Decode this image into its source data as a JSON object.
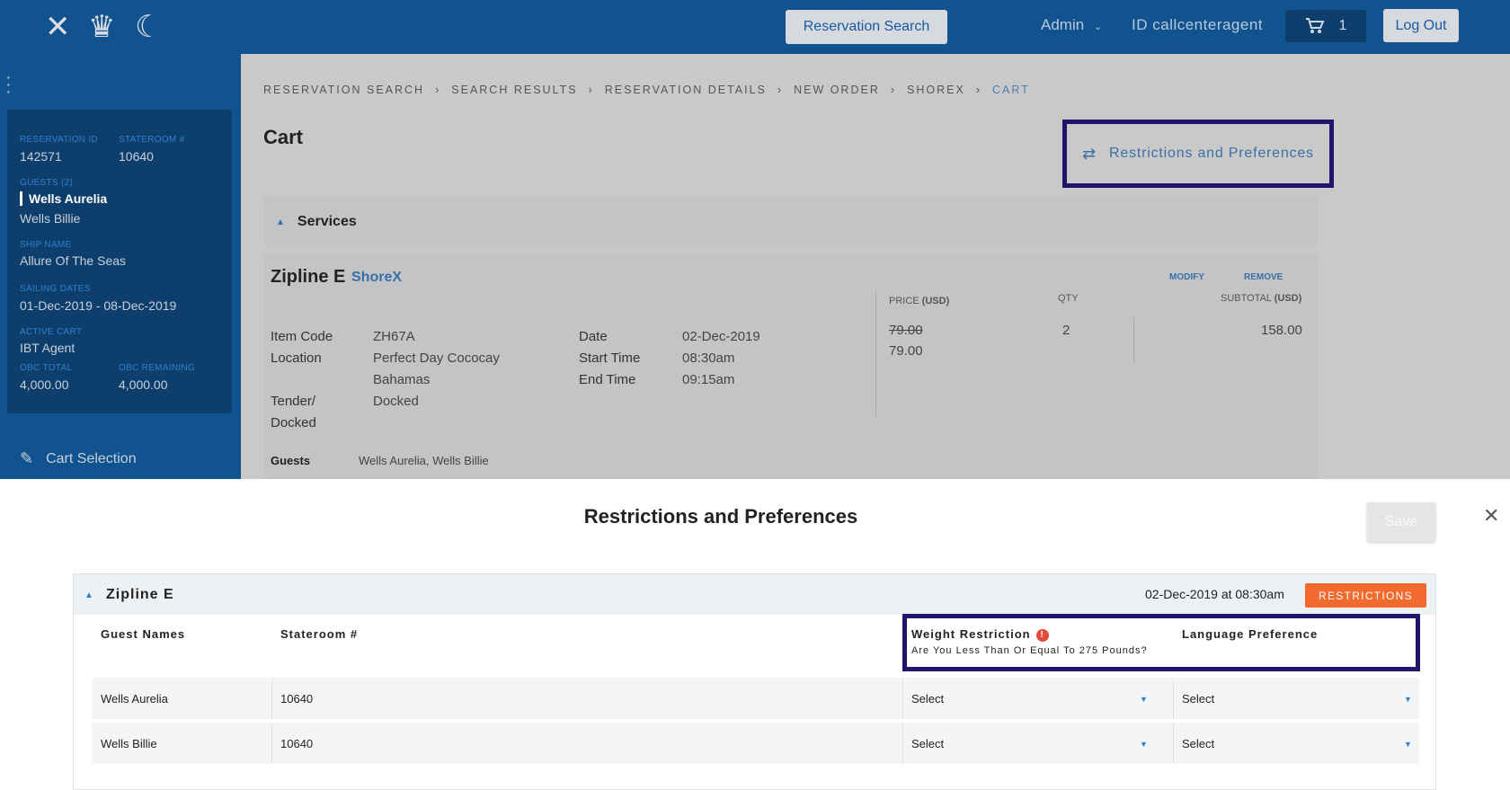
{
  "header": {
    "reservation_search": "Reservation Search",
    "admin": "Admin",
    "id_label": "ID callcenteragent",
    "cart_count": "1",
    "logout": "Log Out"
  },
  "sidebar": {
    "reservation_id_label": "RESERVATION ID",
    "reservation_id": "142571",
    "stateroom_label": "STATEROOM #",
    "stateroom": "10640",
    "guests_label": "GUESTS (2)",
    "guest1": "Wells Aurelia",
    "guest2": "Wells Billie",
    "ship_label": "SHIP NAME",
    "ship": "Allure Of The Seas",
    "sailing_label": "SAILING DATES",
    "sailing": "01-Dec-2019 - 08-Dec-2019",
    "cart_label": "ACTIVE CART",
    "cart": "IBT Agent",
    "obc_total_label": "OBC TOTAL",
    "obc_total": "4,000.00",
    "obc_remaining_label": "OBC REMAINING",
    "obc_remaining": "4,000.00",
    "cart_selection": "Cart Selection"
  },
  "breadcrumb": [
    "RESERVATION SEARCH",
    "SEARCH RESULTS",
    "RESERVATION DETAILS",
    "NEW ORDER",
    "SHOREX",
    "CART"
  ],
  "page": {
    "title": "Cart",
    "restrictions_link": "Restrictions and Preferences",
    "services": "Services"
  },
  "item": {
    "name": "Zipline E",
    "tag": "ShoreX",
    "modify": "MODIFY",
    "remove": "REMOVE",
    "price_label": "PRICE",
    "price_unit": "(USD)",
    "qty_label": "QTY",
    "subtotal_label": "SUBTOTAL",
    "subtotal_unit": "(USD)",
    "item_code_label": "Item Code",
    "item_code": "ZH67A",
    "location_label": "Location",
    "location": "Perfect Day Cococay",
    "location2": "Bahamas",
    "tender_label": "Tender/",
    "tender_label2": "Docked",
    "tender": "Docked",
    "date_label": "Date",
    "date": "02-Dec-2019",
    "start_label": "Start Time",
    "start": "08:30am",
    "end_label": "End Time",
    "end": "09:15am",
    "price_old": "79.00",
    "price": "79.00",
    "qty": "2",
    "subtotal": "158.00",
    "guests_label": "Guests",
    "guests": "Wells Aurelia,  Wells Billie"
  },
  "modal": {
    "title": "Restrictions and Preferences",
    "save": "Save",
    "panel_title": "Zipline E",
    "panel_date": "02-Dec-2019 at 08:30am",
    "restrictions_btn": "RESTRICTIONS",
    "col_guest": "Guest Names",
    "col_stateroom": "Stateroom #",
    "col_weight": "Weight Restriction",
    "weight_question": "Are You Less Than Or Equal To 275 Pounds?",
    "col_language": "Language Preference",
    "rows": [
      {
        "guest": "Wells Aurelia",
        "stateroom": "10640",
        "weight": "Select",
        "language": "Select"
      },
      {
        "guest": "Wells Billie",
        "stateroom": "10640",
        "weight": "Select",
        "language": "Select"
      }
    ]
  }
}
